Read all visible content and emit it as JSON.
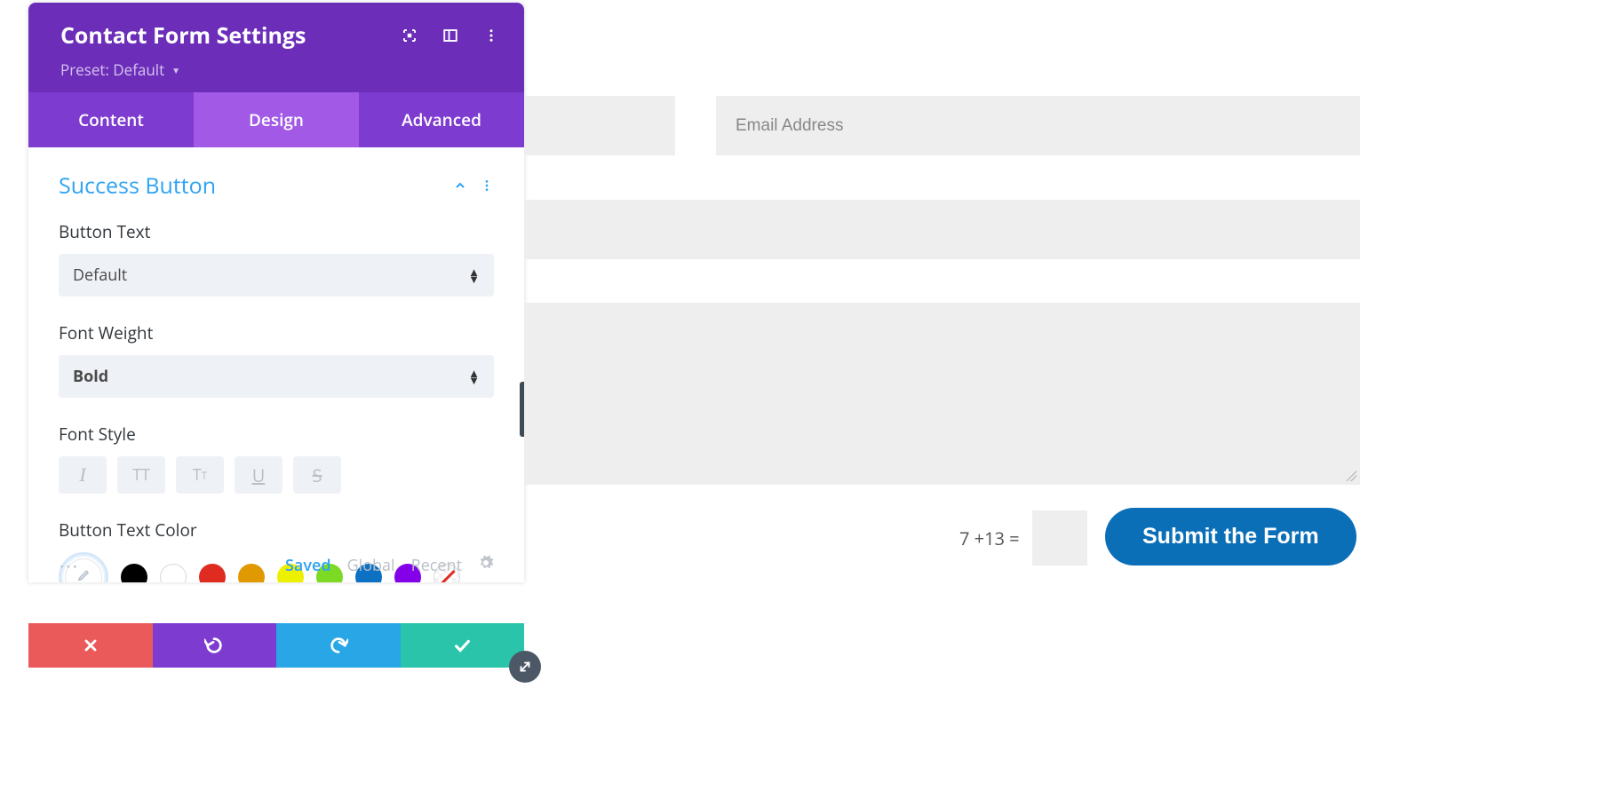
{
  "panel": {
    "title": "Contact Form Settings",
    "preset_label": "Preset: Default",
    "tabs": {
      "content": "Content",
      "design": "Design",
      "advanced": "Advanced",
      "active": "design"
    },
    "section_title": "Success Button",
    "fields": {
      "button_text_label": "Button Text",
      "button_text_value": "Default",
      "font_weight_label": "Font Weight",
      "font_weight_value": "Bold",
      "font_style_label": "Font Style",
      "button_text_color_label": "Button Text Color"
    },
    "palette_tabs": {
      "saved": "Saved",
      "global": "Global",
      "recent": "Recent"
    },
    "colors": {
      "black": "#000000",
      "white": "#ffffff",
      "red": "#e02b20",
      "orange": "#e09900",
      "yellow": "#edf000",
      "green": "#7cda24",
      "blue": "#0c71c3",
      "purple": "#8300e9"
    }
  },
  "form": {
    "email_placeholder": "Email Address",
    "captcha_text": "7 +13 =",
    "submit_label": "Submit the Form"
  }
}
